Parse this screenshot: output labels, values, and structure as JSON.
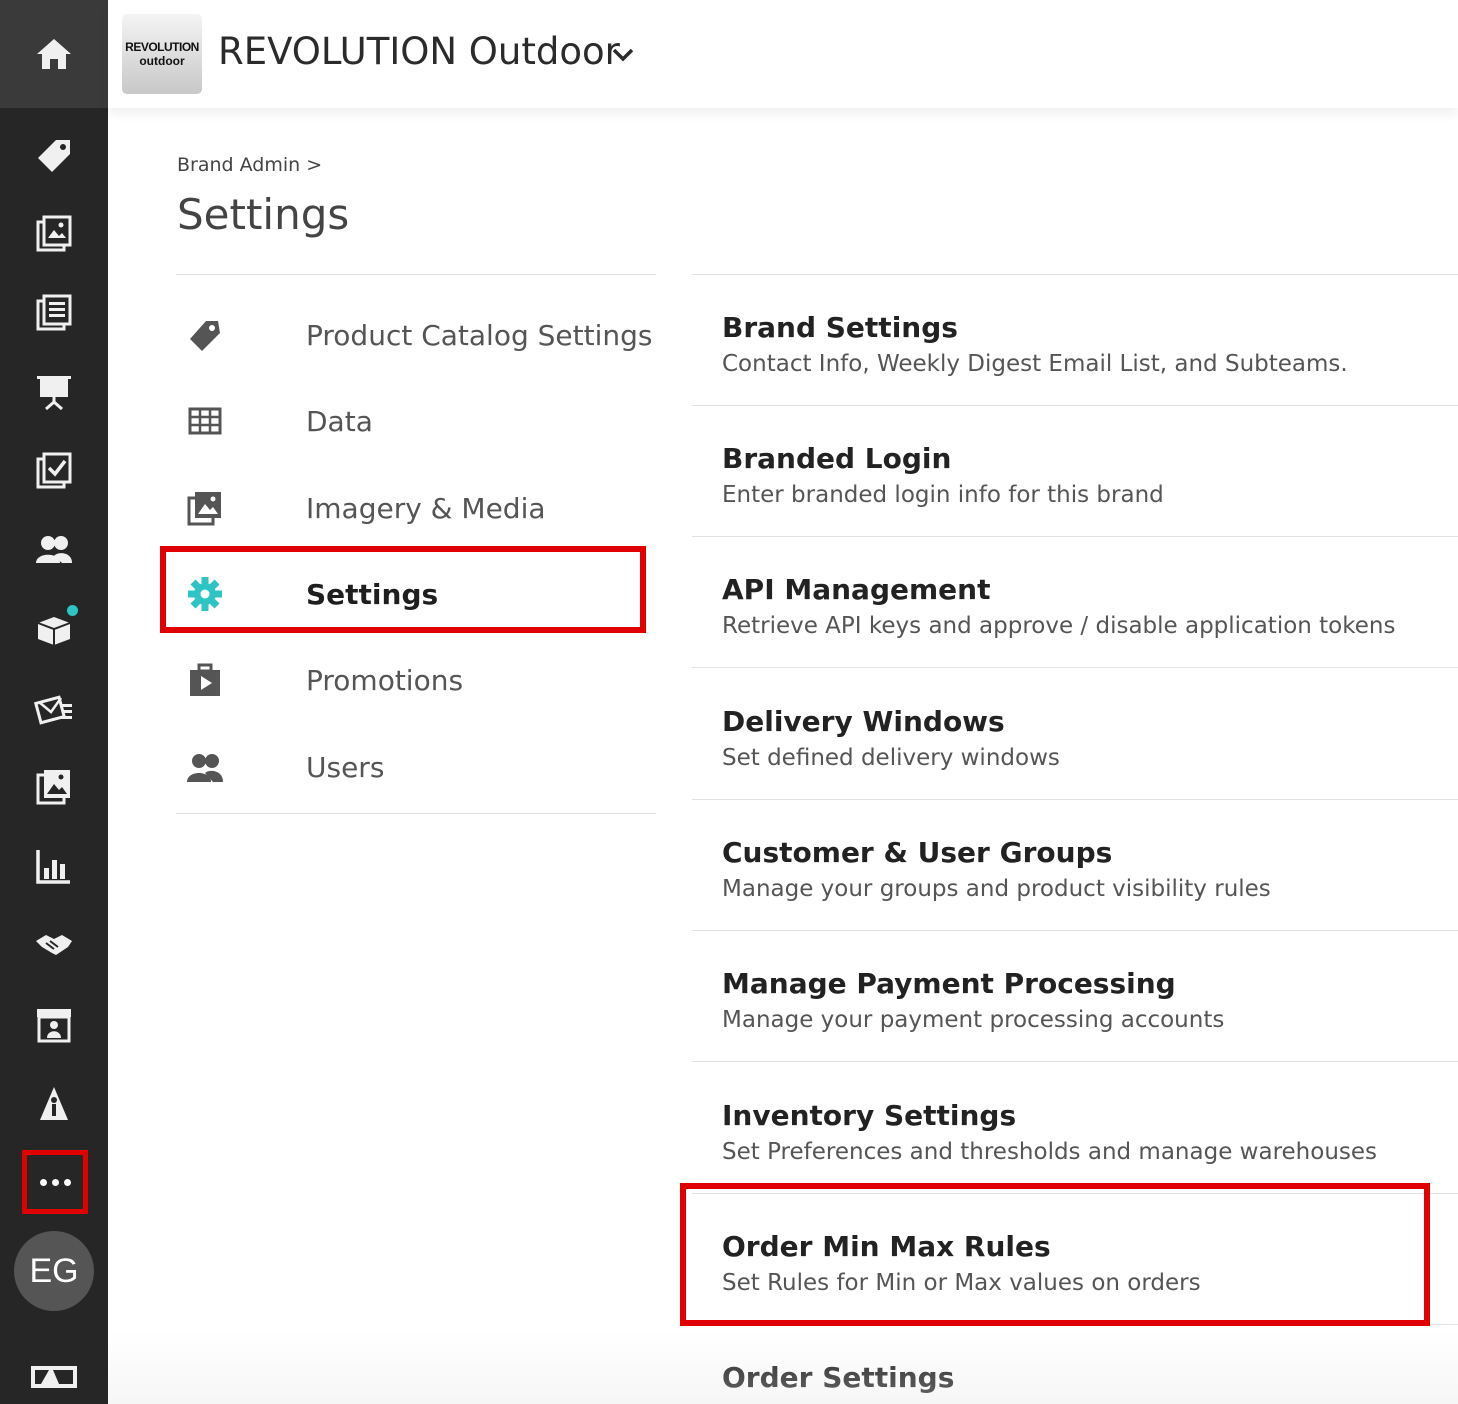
{
  "header": {
    "logo_line1": "REVOLUTION",
    "logo_line2": "outdoor",
    "brand_name": "REVOLUTION Outdoor"
  },
  "breadcrumb": "Brand Admin >",
  "page_title": "Settings",
  "rail": {
    "icons": [
      "home-icon",
      "tag-icon",
      "photo-catalog-icon",
      "document-list-icon",
      "presentation-icon",
      "checklist-icon",
      "users-icon",
      "box-icon",
      "mail-icon",
      "image-icon",
      "chart-icon",
      "handshake-icon",
      "storefront-icon",
      "person-icon"
    ],
    "more_label": "...",
    "avatar_initials": "EG"
  },
  "nav": {
    "items": [
      {
        "label": "Product Catalog Settings",
        "icon": "tag-icon"
      },
      {
        "label": "Data",
        "icon": "table-icon"
      },
      {
        "label": "Imagery & Media",
        "icon": "image-icon"
      },
      {
        "label": "Settings",
        "icon": "gear-icon",
        "active": true
      },
      {
        "label": "Promotions",
        "icon": "promotions-icon"
      },
      {
        "label": "Users",
        "icon": "users-icon"
      }
    ]
  },
  "settings_list": [
    {
      "title": "Brand Settings",
      "desc": "Contact Info, Weekly Digest Email List, and Subteams."
    },
    {
      "title": "Branded Login",
      "desc": "Enter branded login info for this brand"
    },
    {
      "title": "API Management",
      "desc": "Retrieve API keys and approve / disable application tokens"
    },
    {
      "title": "Delivery Windows",
      "desc": "Set defined delivery windows"
    },
    {
      "title": "Customer & User Groups",
      "desc": "Manage your groups and product visibility rules"
    },
    {
      "title": "Manage Payment Processing",
      "desc": "Manage your payment processing accounts"
    },
    {
      "title": "Inventory Settings",
      "desc": "Set Preferences and thresholds and manage warehouses"
    },
    {
      "title": "Order Min Max Rules",
      "desc": "Set Rules for Min or Max values on orders"
    },
    {
      "title": "Order Settings",
      "desc": ""
    }
  ],
  "colors": {
    "rail_bg": "#262626",
    "accent_teal": "#2ec4c4",
    "highlight_red": "#e00000"
  }
}
